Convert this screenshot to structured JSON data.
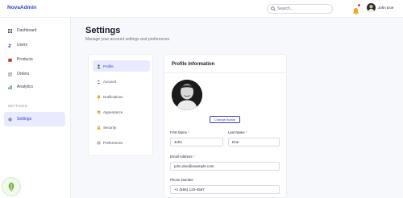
{
  "app": {
    "logo": "NovaAdmin"
  },
  "topbar": {
    "search_placeholder": "Search...",
    "user_name": "John Doe"
  },
  "sidebar": {
    "items": [
      {
        "label": "Dashboard",
        "icon": "dashboard-icon"
      },
      {
        "label": "Users",
        "icon": "users-icon"
      },
      {
        "label": "Products",
        "icon": "products-icon"
      },
      {
        "label": "Orders",
        "icon": "orders-icon"
      },
      {
        "label": "Analytics",
        "icon": "analytics-icon"
      }
    ],
    "section_label": "SETTINGS",
    "settings_item": {
      "label": "Settings",
      "icon": "gear-icon"
    }
  },
  "page": {
    "title": "Settings",
    "subtitle": "Manage your account settings and preferences"
  },
  "tabs": [
    {
      "label": "Profile",
      "icon": "user-icon",
      "active": true
    },
    {
      "label": "Account",
      "icon": "account-icon",
      "active": false
    },
    {
      "label": "Notifications",
      "icon": "bell-icon",
      "active": false
    },
    {
      "label": "Appearance",
      "icon": "palette-icon",
      "active": false
    },
    {
      "label": "Security",
      "icon": "lock-icon",
      "active": false
    },
    {
      "label": "Preferences",
      "icon": "sliders-icon",
      "active": false
    }
  ],
  "profile": {
    "title": "Profile Information",
    "change_avatar": "Change Avatar",
    "first_name_label": "First Name",
    "first_name": "John",
    "last_name_label": "Last Name",
    "last_name": "Doe",
    "email_label": "Email Address",
    "email": "john.doe@example.com",
    "phone_label": "Phone Number",
    "phone": "+1 (555) 123-4567",
    "required_mark": "*"
  },
  "colors": {
    "accent": "#2f3fd6",
    "active_bg": "#e8ebff",
    "alert": "#e53935"
  }
}
